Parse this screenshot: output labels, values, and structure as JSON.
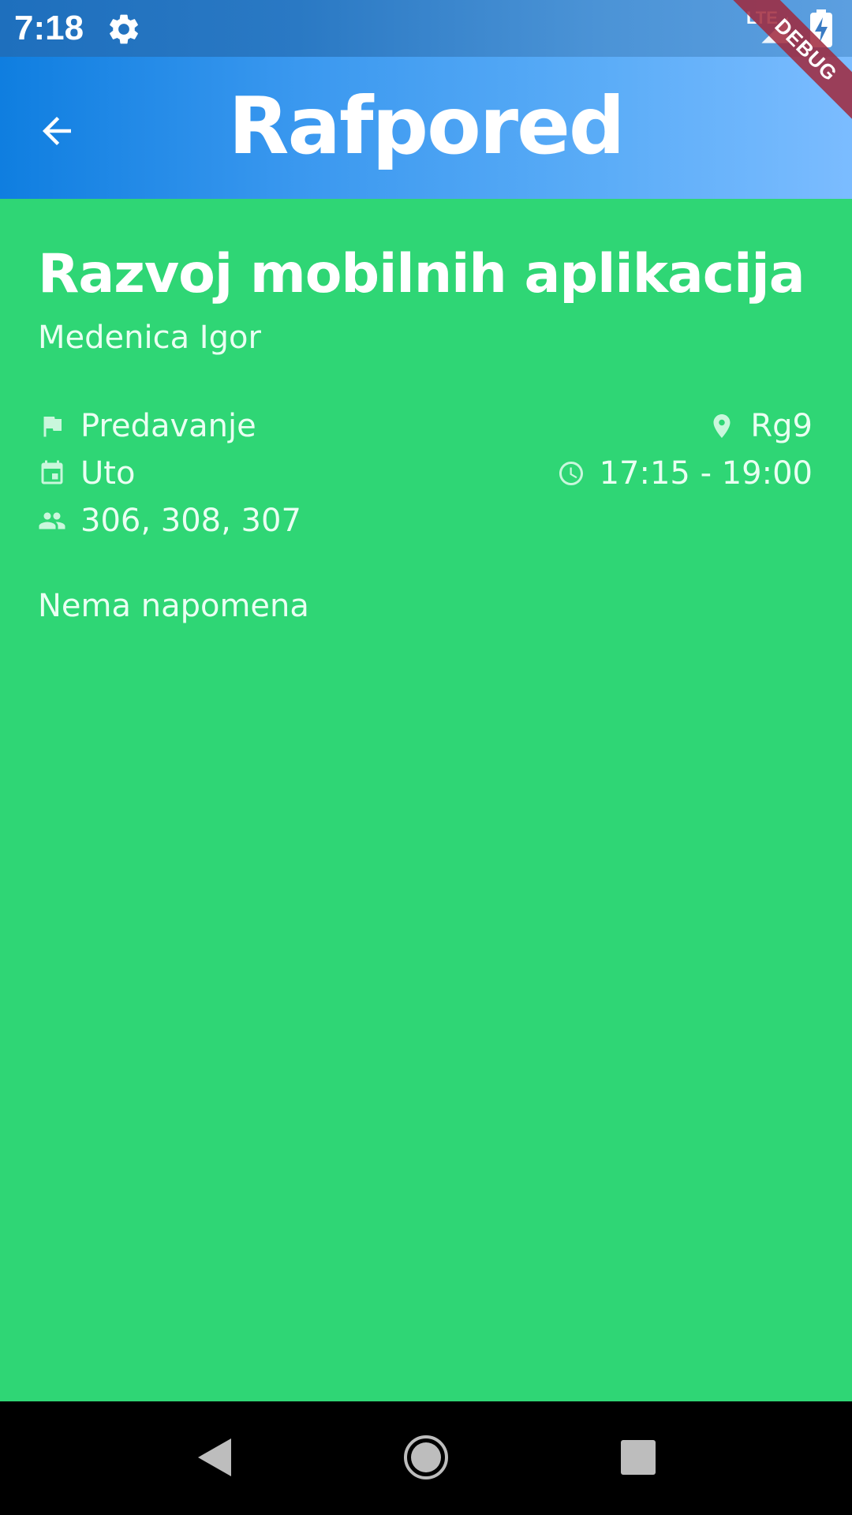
{
  "status_bar": {
    "time": "7:18",
    "network": "LTE"
  },
  "debug_label": "DEBUG",
  "app_bar": {
    "title": "Rafpored"
  },
  "course": {
    "title": "Razvoj mobilnih aplikacija",
    "professor": "Medenica Igor",
    "type": "Predavanje",
    "day": "Uto",
    "groups": "306, 308, 307",
    "room": "Rg9",
    "time": "17:15 - 19:00",
    "note": "Nema napomena"
  },
  "colors": {
    "content_bg": "#2fd675",
    "app_bar_start": "#0f7ee0",
    "app_bar_end": "#7bbcff",
    "text": "#ffffff"
  },
  "icons": {
    "type": "flag-icon",
    "day": "calendar-icon",
    "groups": "people-icon",
    "room": "location-pin-icon",
    "time": "clock-icon"
  }
}
